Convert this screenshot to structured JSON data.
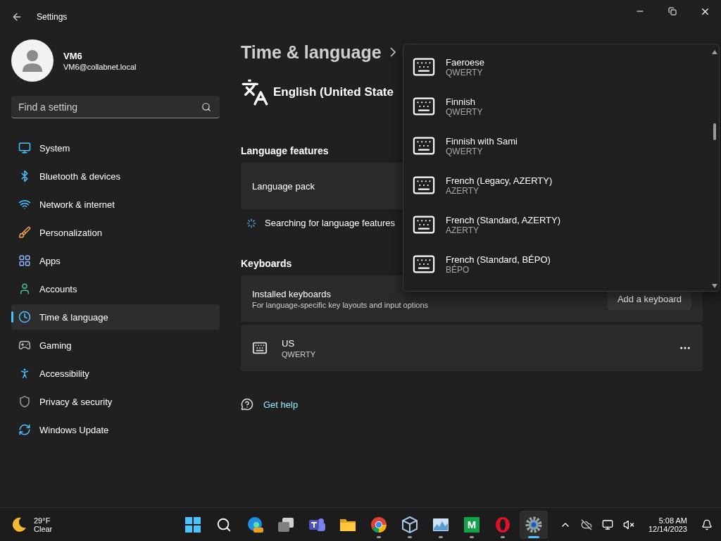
{
  "window": {
    "title": "Settings"
  },
  "user": {
    "name": "VM6",
    "email": "VM6@collabnet.local"
  },
  "search": {
    "placeholder": "Find a setting"
  },
  "nav": [
    {
      "label": "System",
      "kind": "system",
      "selected": false
    },
    {
      "label": "Bluetooth & devices",
      "kind": "bluetooth",
      "selected": false
    },
    {
      "label": "Network & internet",
      "kind": "network",
      "selected": false
    },
    {
      "label": "Personalization",
      "kind": "personalization",
      "selected": false
    },
    {
      "label": "Apps",
      "kind": "apps",
      "selected": false
    },
    {
      "label": "Accounts",
      "kind": "accounts",
      "selected": false
    },
    {
      "label": "Time & language",
      "kind": "time",
      "selected": true
    },
    {
      "label": "Gaming",
      "kind": "gaming",
      "selected": false
    },
    {
      "label": "Accessibility",
      "kind": "accessibility",
      "selected": false
    },
    {
      "label": "Privacy & security",
      "kind": "privacy",
      "selected": false
    },
    {
      "label": "Windows Update",
      "kind": "update",
      "selected": false
    }
  ],
  "breadcrumb": "Time & language",
  "language": "English (United State",
  "language_features": {
    "heading": "Language features",
    "pack_label": "Language pack",
    "status": "Searching for language features"
  },
  "keyboards": {
    "heading": "Keyboards",
    "title": "Installed keyboards",
    "subtitle": "For language-specific key layouts and input options",
    "add_button": "Add a keyboard",
    "installed": [
      {
        "name": "US",
        "layout": "QWERTY"
      }
    ]
  },
  "help": "Get help",
  "dropdown": {
    "items": [
      {
        "name": "Faeroese",
        "layout": "QWERTY"
      },
      {
        "name": "Finnish",
        "layout": "QWERTY"
      },
      {
        "name": "Finnish with Sami",
        "layout": "QWERTY"
      },
      {
        "name": "French (Legacy, AZERTY)",
        "layout": "AZERTY"
      },
      {
        "name": "French (Standard, AZERTY)",
        "layout": "AZERTY"
      },
      {
        "name": "French (Standard, BÉPO)",
        "layout": "BÉPO"
      }
    ]
  },
  "taskbar": {
    "weather": {
      "temp": "29°F",
      "condition": "Clear"
    },
    "apps": [
      {
        "kind": "start",
        "running": false,
        "active": false
      },
      {
        "kind": "search",
        "running": false,
        "active": false
      },
      {
        "kind": "edge",
        "running": false,
        "active": false
      },
      {
        "kind": "taskview",
        "running": false,
        "active": false
      },
      {
        "kind": "teams",
        "running": false,
        "active": false
      },
      {
        "kind": "explorer",
        "running": false,
        "active": false
      },
      {
        "kind": "chrome",
        "running": true,
        "active": false
      },
      {
        "kind": "vbox",
        "running": true,
        "active": false
      },
      {
        "kind": "monitor",
        "running": true,
        "active": false
      },
      {
        "kind": "letter",
        "label": "M",
        "running": true,
        "active": false
      },
      {
        "kind": "opera",
        "running": true,
        "active": false
      },
      {
        "kind": "settings",
        "running": true,
        "active": true
      }
    ],
    "time": "5:08 AM",
    "date": "12/14/2023"
  }
}
